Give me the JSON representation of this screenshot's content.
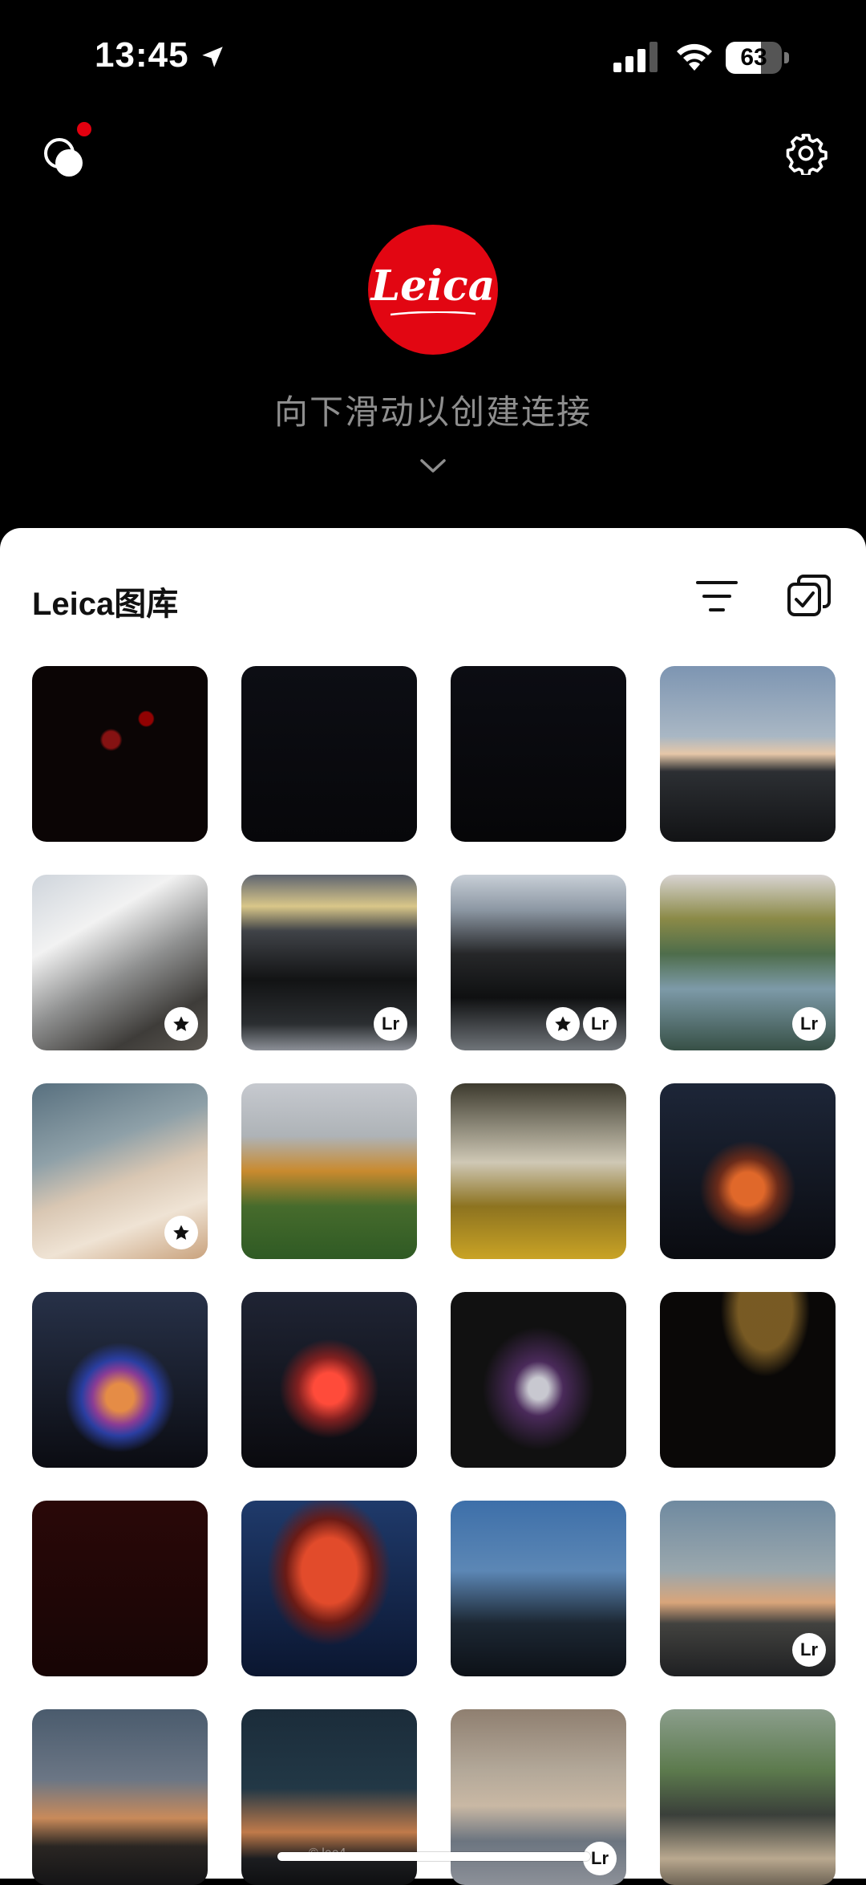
{
  "status_bar": {
    "time": "13:45",
    "battery": "63",
    "battery_level": 0.63
  },
  "header": {
    "logo_text": "Leica",
    "hint": "向下滑动以创建连接"
  },
  "gallery": {
    "title": "Leica图库",
    "photos": [
      {
        "name": "red-lights-night",
        "badges": []
      },
      {
        "name": "dark-night-sky-1",
        "badges": []
      },
      {
        "name": "dark-night-sky-2",
        "badges": []
      },
      {
        "name": "snow-mountain-sunrise",
        "badges": []
      },
      {
        "name": "glacier-mountain",
        "badges": [
          "star"
        ]
      },
      {
        "name": "valley-clouds-river",
        "badges": [
          "Lr"
        ]
      },
      {
        "name": "valley-river-mountains",
        "badges": [
          "star",
          "Lr"
        ]
      },
      {
        "name": "canal-autumn-trees",
        "badges": [
          "Lr"
        ]
      },
      {
        "name": "railing-dog-sky",
        "badges": [
          "star"
        ]
      },
      {
        "name": "autumn-park-path",
        "badges": []
      },
      {
        "name": "dog-fence-yellow-leaves",
        "badges": []
      },
      {
        "name": "castle-light-show-1",
        "badges": []
      },
      {
        "name": "castle-light-show-2",
        "badges": []
      },
      {
        "name": "castle-light-show-3",
        "badges": []
      },
      {
        "name": "circus-entrance",
        "badges": []
      },
      {
        "name": "dark-lights-arc",
        "badges": []
      },
      {
        "name": "red-dark-figures",
        "badges": []
      },
      {
        "name": "circus-tent",
        "badges": []
      },
      {
        "name": "circus-gate-dusk",
        "badges": []
      },
      {
        "name": "wind-turbine-sunset",
        "badges": [
          "Lr"
        ]
      },
      {
        "name": "dusk-horizon",
        "badges": []
      },
      {
        "name": "comet-sky",
        "badges": [],
        "watermark": "© lee4"
      },
      {
        "name": "shiba-dog-street",
        "badges": [
          "Lr"
        ]
      },
      {
        "name": "people-dog-hillside",
        "badges": []
      }
    ]
  },
  "colors": {
    "leica_red": "#e20612",
    "sheet_bg": "#ffffff",
    "top_bg": "#000000",
    "hint_gray": "#8e8e8e"
  },
  "icons": [
    "location-arrow-icon",
    "signal-icon",
    "wifi-icon",
    "battery-icon",
    "circles-icon",
    "gear-icon",
    "chevron-down-icon",
    "filter-icon",
    "select-icon",
    "star-icon"
  ]
}
